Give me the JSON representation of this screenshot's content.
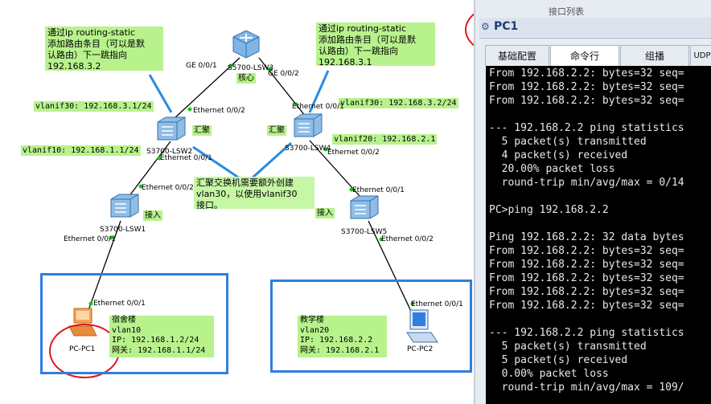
{
  "topology": {
    "notes": {
      "left_route": [
        "通过ip routing-static",
        "添加路由条目（可以是默",
        "认路由）下一跳指向",
        "192.168.3.2"
      ],
      "right_route": [
        "通过ip routing-static",
        "添加路由条目（可以是默",
        "认路由）下一跳指向",
        "192.168.3.1"
      ],
      "vlanif_note": [
        "汇聚交换机需要额外创建",
        "vlan30，以使用vlanif30",
        "接口。"
      ]
    },
    "devices": {
      "core": {
        "name": "S5700-LSW3",
        "role": "核心"
      },
      "agg_left": {
        "name": "S3700-LSW2",
        "role": "汇聚"
      },
      "agg_right": {
        "name": "S3700-LSW4",
        "role": "汇聚"
      },
      "acc_left": {
        "name": "S3700-LSW1",
        "role": "接入"
      },
      "acc_right": {
        "name": "S3700-LSW5",
        "role": "接入"
      },
      "pc1": {
        "name": "PC-PC1"
      },
      "pc2": {
        "name": "PC-PC2"
      }
    },
    "ports": {
      "core_left": "GE 0/0/1",
      "core_right": "GE 0/0/2",
      "lsw2_up": "Ethernet 0/0/2",
      "lsw2_down": "Ethernet 0/0/1",
      "lsw4_up": "Ethernet 0/0/1",
      "lsw4_down": "Ethernet 0/0/2",
      "lsw1_up": "Ethernet 0/0/2",
      "lsw1_down": "Ethernet 0/0/1",
      "lsw5_up": "Ethernet 0/0/1",
      "lsw5_down": "Ethernet 0/0/2",
      "pc1_port": "Ethernet 0/0/1",
      "pc2_port": "Ethernet 0/0/1"
    },
    "vlanifs": {
      "lsw2_v30": "vlanif30: 192.168.3.1/24",
      "lsw2_v10": "vlanif10: 192.168.1.1/24",
      "lsw4_v30": "vlanif30: 192.168.3.2/24",
      "lsw4_v20": "vlanif20: 192.168.2.1"
    },
    "hosts": {
      "dorm": {
        "building": "宿舍楼",
        "vlan": "vlan10",
        "ip": "IP: 192.168.1.2/24",
        "gw": "网关: 192.168.1.1/24"
      },
      "teach": {
        "building": "教学楼",
        "vlan": "vlan20",
        "ip": "IP: 192.168.2.2",
        "gw": "网关: 192.168.2.1"
      }
    }
  },
  "pc_window": {
    "top_tab": "接口列表",
    "title": "PC1",
    "tabs": [
      "基础配置",
      "命令行",
      "组播",
      "UDP发"
    ],
    "active_tab": 1,
    "terminal_lines": [
      "From 192.168.2.2: bytes=32 seq=",
      "From 192.168.2.2: bytes=32 seq=",
      "From 192.168.2.2: bytes=32 seq=",
      "",
      "--- 192.168.2.2 ping statistics",
      "  5 packet(s) transmitted",
      "  4 packet(s) received",
      "  20.00% packet loss",
      "  round-trip min/avg/max = 0/14",
      "",
      "PC>ping 192.168.2.2",
      "",
      "Ping 192.168.2.2: 32 data bytes",
      "From 192.168.2.2: bytes=32 seq=",
      "From 192.168.2.2: bytes=32 seq=",
      "From 192.168.2.2: bytes=32 seq=",
      "From 192.168.2.2: bytes=32 seq=",
      "From 192.168.2.2: bytes=32 seq=",
      "",
      "--- 192.168.2.2 ping statistics",
      "  5 packet(s) transmitted",
      "  5 packet(s) received",
      "  0.00% packet loss",
      "  round-trip min/avg/max = 109/"
    ]
  },
  "colors": {
    "note_bg": "#b8f28c",
    "box_blue": "#2f7fe0",
    "annotation_red": "#e0161b",
    "link_blue": "#2a8be0"
  }
}
